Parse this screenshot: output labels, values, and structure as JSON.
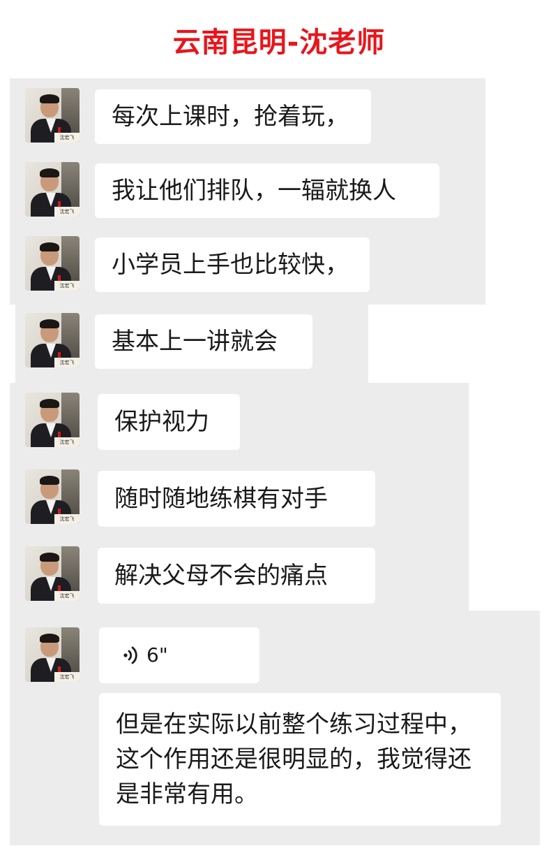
{
  "title": "云南昆明-沈老师",
  "avatar": {
    "name_tag": "沈宏飞"
  },
  "messages": [
    {
      "type": "text",
      "text": "每次上课时，抢着玩，"
    },
    {
      "type": "text",
      "text": "我让他们排队，一辐就换人"
    },
    {
      "type": "text",
      "text": "小学员上手也比较快，"
    },
    {
      "type": "text",
      "text": "基本上一讲就会"
    },
    {
      "type": "text",
      "text": "保护视力"
    },
    {
      "type": "text",
      "text": "随时随地练棋有对手"
    },
    {
      "type": "text",
      "text": "解决父母不会的痛点"
    },
    {
      "type": "voice",
      "duration": "6\""
    },
    {
      "type": "text",
      "text": "但是在实际以前整个练习过程中，这个作用还是很明显的，我觉得还是非常有用。"
    }
  ],
  "colors": {
    "title": "#e8151b",
    "panel": "#ececec",
    "bubble": "#ffffff"
  }
}
